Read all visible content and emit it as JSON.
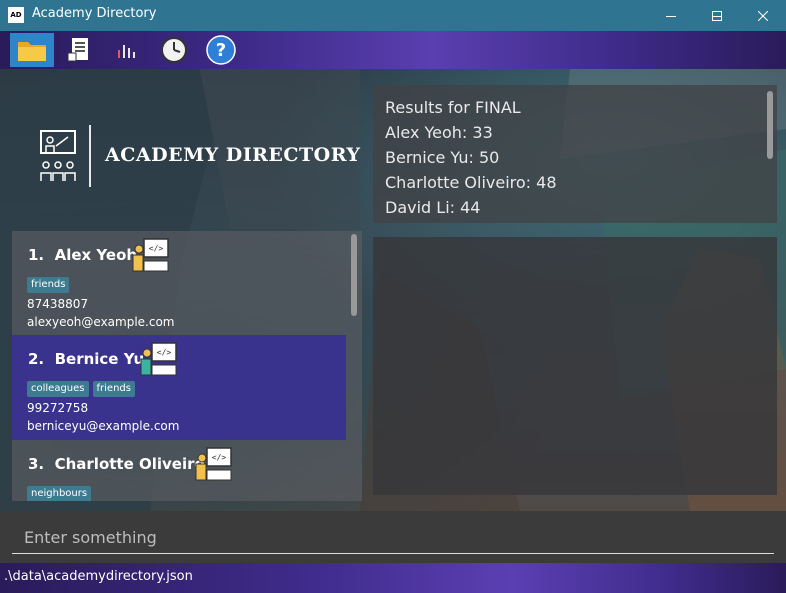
{
  "window": {
    "title": "Academy Directory",
    "app_icon_text": "AD"
  },
  "toolbar": {
    "buttons": [
      {
        "icon": "folder-icon",
        "active": true
      },
      {
        "icon": "document-icon",
        "active": false
      },
      {
        "icon": "bar-chart-icon",
        "active": false
      },
      {
        "icon": "clock-icon",
        "active": false
      },
      {
        "icon": "help-icon",
        "active": false
      }
    ]
  },
  "logo": {
    "text": "ACADEMY DIRECTORY",
    "icon": "classroom-icon"
  },
  "persons": [
    {
      "index": "1.",
      "name": "Alex Yeoh",
      "tags": [
        "friends"
      ],
      "phone": "87438807",
      "email": "alexyeoh@example.com",
      "selected": false
    },
    {
      "index": "2.",
      "name": "Bernice Yu",
      "tags": [
        "colleagues",
        "friends"
      ],
      "phone": "99272758",
      "email": "berniceyu@example.com",
      "selected": true
    },
    {
      "index": "3.",
      "name": "Charlotte Oliveiro",
      "tags": [
        "neighbours"
      ],
      "phone": "",
      "email": "",
      "selected": false
    }
  ],
  "result": {
    "lines": [
      "Results for FINAL",
      "Alex Yeoh: 33",
      "Bernice Yu: 50",
      "Charlotte Oliveiro: 48",
      "David Li: 44"
    ]
  },
  "command": {
    "placeholder": "Enter something",
    "value": ""
  },
  "status": {
    "path": ".\\data\\academydirectory.json"
  },
  "colors": {
    "title_bar": "#2f7592",
    "selected_card": "#3a338e",
    "tag": "#3e7b91",
    "active_toolbar_button": "#2e86c9"
  }
}
